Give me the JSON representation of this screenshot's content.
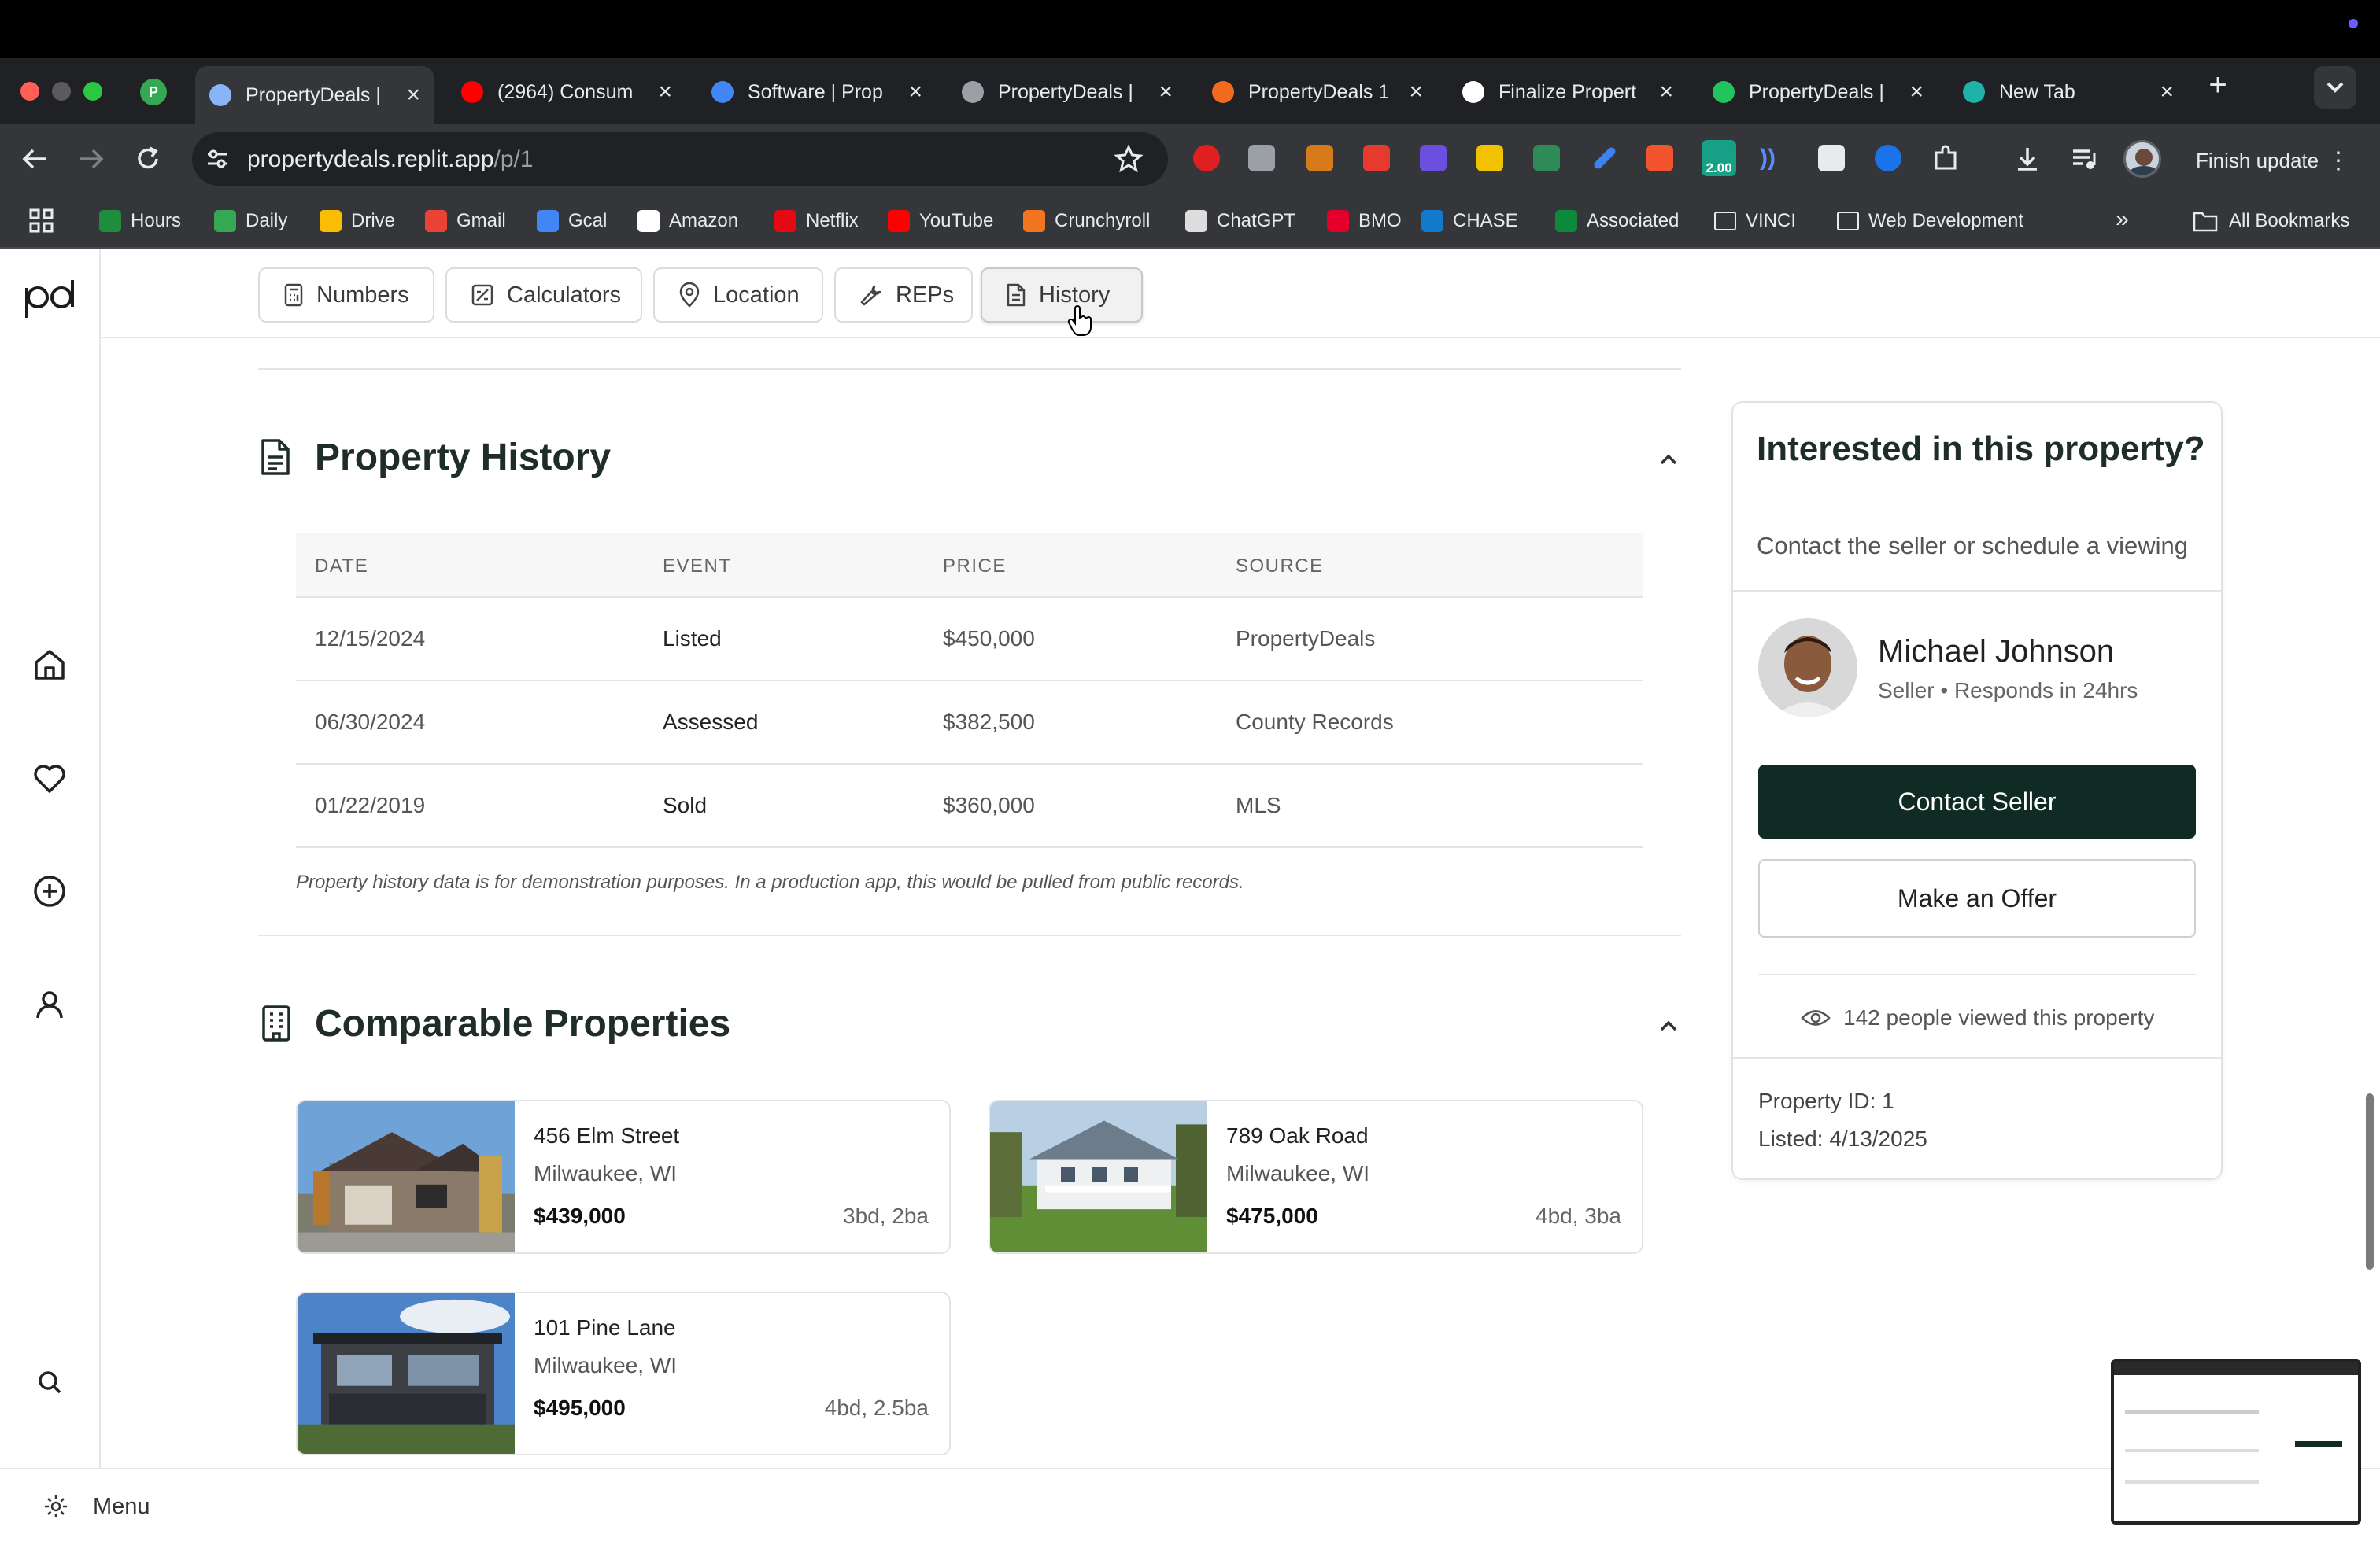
{
  "browser": {
    "tabs": [
      {
        "title": "PropertyDeals |",
        "fav_color": "#8ab4f8",
        "active": true
      },
      {
        "title": "(2964) Consum",
        "fav_color": "#ff0000"
      },
      {
        "title": "Software | Prop",
        "fav_color": "#4285f4"
      },
      {
        "title": "PropertyDeals |",
        "fav_color": "#9aa0a6"
      },
      {
        "title": "PropertyDeals 1",
        "fav_color": "#f26b1d"
      },
      {
        "title": "Finalize Propert",
        "fav_color": "#ffffff"
      },
      {
        "title": "PropertyDeals |",
        "fav_color": "#21c55d"
      },
      {
        "title": "New Tab",
        "fav_color": "#20b2aa"
      }
    ],
    "profile_badge": "P",
    "url_host": "propertydeals.replit.app",
    "url_path": "/p/1",
    "extension_badge": "2.00",
    "finish_update": "Finish update",
    "bookmarks": [
      {
        "label": "Hours",
        "color": "#1e8e3e"
      },
      {
        "label": "Daily",
        "color": "#34a853"
      },
      {
        "label": "Drive",
        "color": "#fbbc04"
      },
      {
        "label": "Gmail",
        "color": "#ea4335"
      },
      {
        "label": "Gcal",
        "color": "#4285f4"
      },
      {
        "label": "Amazon",
        "color": "#ffffff"
      },
      {
        "label": "Netflix",
        "color": "#e50914"
      },
      {
        "label": "YouTube",
        "color": "#ff0000"
      },
      {
        "label": "Crunchyroll",
        "color": "#f47521"
      },
      {
        "label": "ChatGPT",
        "color": "#dddddd"
      },
      {
        "label": "BMO",
        "color": "#e4002b"
      },
      {
        "label": "CHASE",
        "color": "#117aca"
      },
      {
        "label": "Associated",
        "color": "#0a8a3a"
      },
      {
        "label": "VINCI",
        "color": "folder"
      },
      {
        "label": "Web Development",
        "color": "folder"
      }
    ],
    "all_bookmarks": "All Bookmarks"
  },
  "app": {
    "logo": "pd",
    "tabs": [
      {
        "label": "Numbers",
        "icon": "calculator-icon"
      },
      {
        "label": "Calculators",
        "icon": "calc-square-icon"
      },
      {
        "label": "Location",
        "icon": "map-pin-icon"
      },
      {
        "label": "REPs",
        "icon": "wrench-icon"
      },
      {
        "label": "History",
        "icon": "document-icon",
        "active": true
      }
    ],
    "history": {
      "title": "Property History",
      "columns": [
        "DATE",
        "EVENT",
        "PRICE",
        "SOURCE"
      ],
      "rows": [
        {
          "date": "12/15/2024",
          "event": "Listed",
          "price": "$450,000",
          "source": "PropertyDeals"
        },
        {
          "date": "06/30/2024",
          "event": "Assessed",
          "price": "$382,500",
          "source": "County Records"
        },
        {
          "date": "01/22/2019",
          "event": "Sold",
          "price": "$360,000",
          "source": "MLS"
        }
      ],
      "note": "Property history data is for demonstration purposes. In a production app, this would be pulled from public records."
    },
    "comparables": {
      "title": "Comparable Properties",
      "items": [
        {
          "address": "456 Elm Street",
          "city": "Milwaukee, WI",
          "price": "$439,000",
          "beds": "3bd, 2ba"
        },
        {
          "address": "789 Oak Road",
          "city": "Milwaukee, WI",
          "price": "$475,000",
          "beds": "4bd, 3ba"
        },
        {
          "address": "101 Pine Lane",
          "city": "Milwaukee, WI",
          "price": "$495,000",
          "beds": "4bd, 2.5ba"
        }
      ]
    },
    "contact_card": {
      "heading": "Interested in this property?",
      "subheading": "Contact the seller or schedule a viewing",
      "seller_name": "Michael Johnson",
      "seller_meta": "Seller • Responds in 24hrs",
      "contact_button": "Contact Seller",
      "offer_button": "Make an Offer",
      "views": "142 people viewed this property",
      "property_id": "Property ID: 1",
      "listed": "Listed: 4/13/2025"
    },
    "menu_label": "Menu"
  },
  "colors": {
    "primary_dark": "#102b23",
    "heading": "#1f2d2a"
  }
}
